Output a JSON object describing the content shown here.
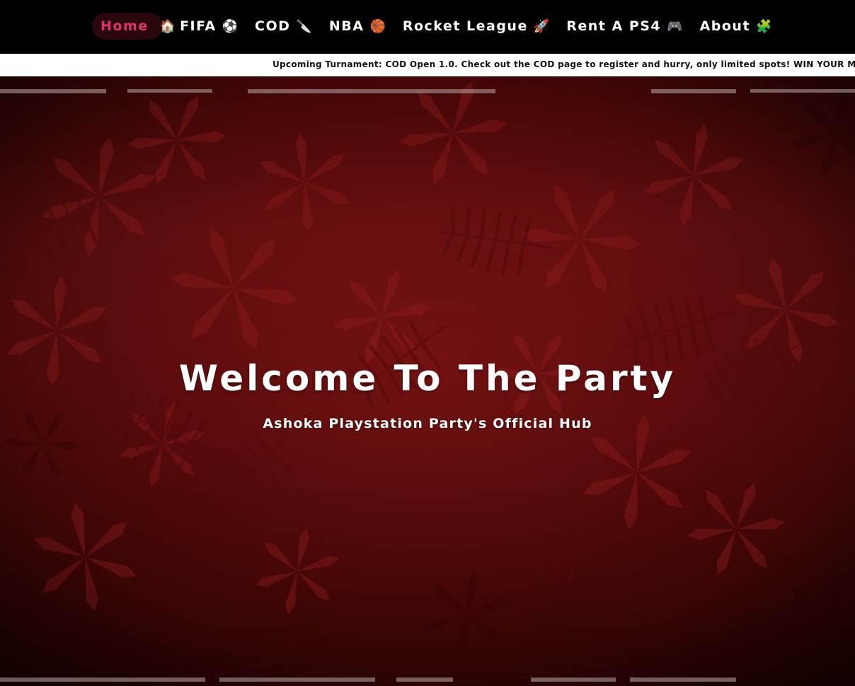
{
  "nav": {
    "items": [
      {
        "label": "Home",
        "icon": "🏠",
        "icon_name": "house-icon",
        "active": true
      },
      {
        "label": "FIFA",
        "icon": "⚽",
        "icon_name": "soccer-ball-icon",
        "active": false
      },
      {
        "label": "COD",
        "icon": "🔪",
        "icon_name": "knife-icon",
        "active": false
      },
      {
        "label": "NBA",
        "icon": "🏀",
        "icon_name": "basketball-icon",
        "active": false
      },
      {
        "label": "Rocket League",
        "icon": "🚀",
        "icon_name": "rocket-icon",
        "active": false
      },
      {
        "label": "Rent A PS4",
        "icon": "🎮",
        "icon_name": "gamepad-icon",
        "active": false
      },
      {
        "label": "About",
        "icon": "🧩",
        "icon_name": "puzzle-piece-icon",
        "active": false
      }
    ]
  },
  "ticker": {
    "text": "Upcoming Turnament: COD Open 1.0. Check out the COD page to register and hurry, only limited spots! WIN YOUR MONE"
  },
  "hero": {
    "title": "Welcome To The Party",
    "subtitle": "Ashoka Playstation Party's Official Hub"
  },
  "colors": {
    "nav_background": "#000000",
    "nav_active_text": "#e0336a",
    "nav_active_pill": "#2a070b",
    "ticker_background": "#ffffff",
    "hero_tint": "#6a0f0f"
  }
}
